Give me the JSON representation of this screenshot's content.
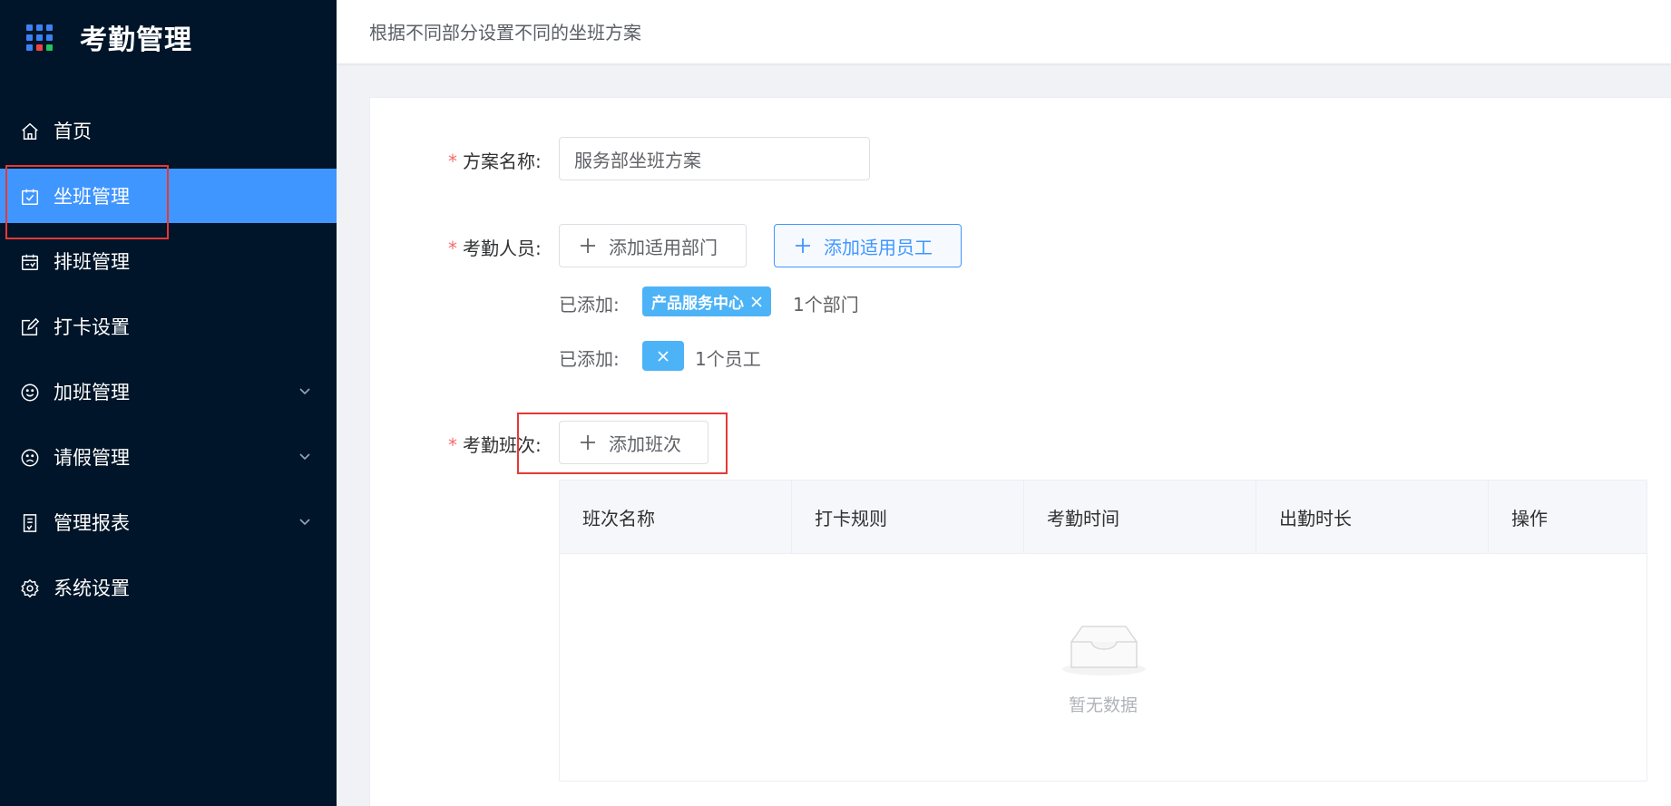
{
  "app": {
    "title": "考勤管理",
    "logo_colors": [
      "#3b82f6",
      "#3b82f6",
      "#3b82f6",
      "#3b82f6",
      "#3b82f6",
      "#3b82f6",
      "#3b82f6",
      "#ef4444",
      "#22c55e"
    ]
  },
  "sidebar": {
    "items": [
      {
        "label": "首页",
        "icon": "home-icon",
        "active": false,
        "expandable": false
      },
      {
        "label": "坐班管理",
        "icon": "calendar-check-icon",
        "active": true,
        "expandable": false
      },
      {
        "label": "排班管理",
        "icon": "schedule-icon",
        "active": false,
        "expandable": false
      },
      {
        "label": "打卡设置",
        "icon": "edit-icon",
        "active": false,
        "expandable": false
      },
      {
        "label": "加班管理",
        "icon": "smile-icon",
        "active": false,
        "expandable": true
      },
      {
        "label": "请假管理",
        "icon": "frown-icon",
        "active": false,
        "expandable": true
      },
      {
        "label": "管理报表",
        "icon": "report-icon",
        "active": false,
        "expandable": true
      },
      {
        "label": "系统设置",
        "icon": "gear-icon",
        "active": false,
        "expandable": false
      }
    ]
  },
  "header": {
    "subtitle": "根据不同部分设置不同的坐班方案"
  },
  "form": {
    "plan_name": {
      "label": "方案名称:",
      "value": "服务部坐班方案"
    },
    "attendees": {
      "label": "考勤人员:",
      "add_dept_button": "添加适用部门",
      "add_employee_button": "添加适用员工",
      "added_prefix": "已添加:",
      "dept_tags": [
        "产品服务中心"
      ],
      "dept_count": "1个部门",
      "employee_tags": [
        ""
      ],
      "employee_count": "1个员工"
    },
    "shifts": {
      "label": "考勤班次:",
      "add_shift_button": "添加班次",
      "table": {
        "columns": [
          "班次名称",
          "打卡规则",
          "考勤时间",
          "出勤时长",
          "操作"
        ],
        "rows": [],
        "empty_text": "暂无数据"
      }
    }
  },
  "colors": {
    "sidebar_bg": "#001529",
    "accent": "#4096ff",
    "tag_bg": "#4db3f7",
    "required": "#f56c6c",
    "highlight": "#e53935"
  }
}
